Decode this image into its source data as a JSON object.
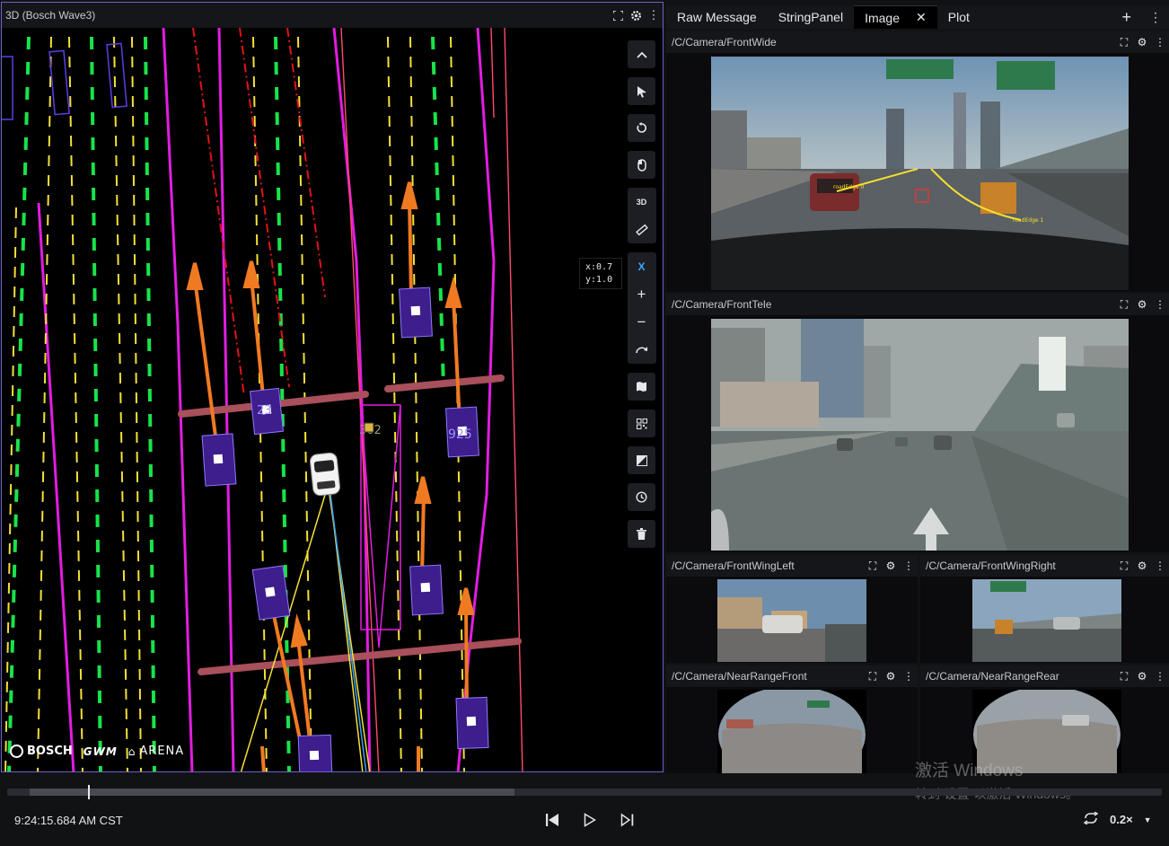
{
  "panel3d": {
    "title": "3D (Bosch Wave3)",
    "coord_x": "x:0.7",
    "coord_y": "y:1.0",
    "toolbar_text_3d": "3D",
    "toolbar_x": "X",
    "object_labels": [
      "302",
      "23",
      "925"
    ],
    "logos": {
      "bosch": "BOSCH",
      "gwm": "GWM",
      "arena": "ARENA"
    }
  },
  "tabs": [
    {
      "label": "Raw Message"
    },
    {
      "label": "StringPanel"
    },
    {
      "label": "Image",
      "active": true
    },
    {
      "label": "Plot"
    }
  ],
  "cameras": {
    "front_wide": "/C/Camera/FrontWide",
    "front_tele": "/C/Camera/FrontTele",
    "front_wing_left": "/C/Camera/FrontWingLeft",
    "front_wing_right": "/C/Camera/FrontWingRight",
    "near_range_front": "/C/Camera/NearRangeFront",
    "near_range_rear": "/C/Camera/NearRangeRear"
  },
  "front_wide_labels": {
    "edge_left": "roadEdge 0",
    "edge_right": "roadEdge 1"
  },
  "playback": {
    "time": "9:24:15.684 AM CST",
    "speed": "0.2×",
    "progress_fraction": 0.07,
    "loaded_fraction": 0.42
  },
  "watermark": {
    "line1": "激活 Windows",
    "line2": "转到“设置”以激活 Windows。"
  },
  "colors": {
    "accent_border": "#6b63c9",
    "lane_green": "#19e34a",
    "lane_yellow": "#f4e03a",
    "lane_magenta": "#e21de0",
    "arrow_orange": "#f07a22",
    "object_purple": "#3e1d8c"
  }
}
